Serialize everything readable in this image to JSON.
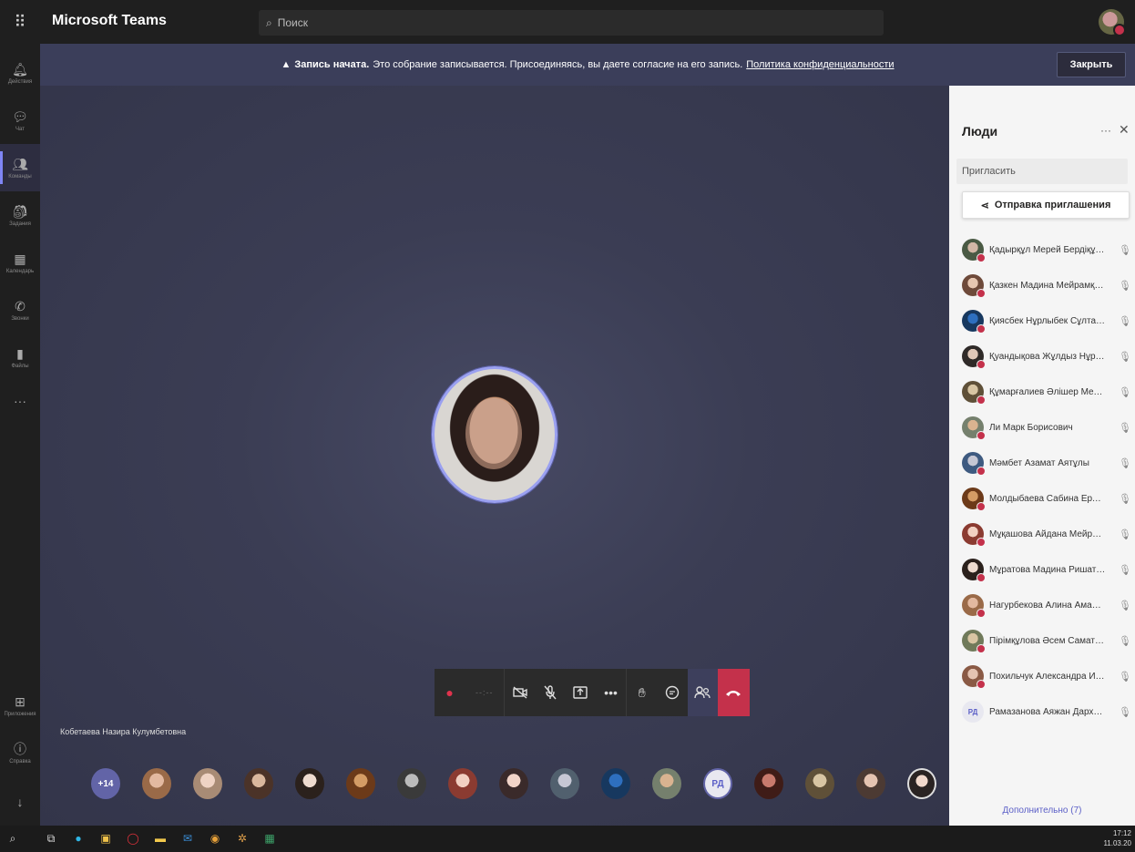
{
  "app": {
    "name": "Microsoft Teams",
    "search_placeholder": "Поиск"
  },
  "rail": {
    "items": [
      {
        "label": "Действия",
        "icon": "bell-icon",
        "active": false
      },
      {
        "label": "Чат",
        "icon": "chat-icon",
        "active": false
      },
      {
        "label": "Команды",
        "icon": "teams-icon",
        "active": true
      },
      {
        "label": "Задания",
        "icon": "assignments-icon",
        "active": false
      },
      {
        "label": "Календарь",
        "icon": "calendar-icon",
        "active": false
      },
      {
        "label": "Звонки",
        "icon": "phone-icon",
        "active": false
      },
      {
        "label": "Файлы",
        "icon": "files-icon",
        "active": false
      }
    ],
    "bottom": [
      {
        "label": "Приложения",
        "icon": "apps-icon"
      },
      {
        "label": "Справка",
        "icon": "help-icon"
      }
    ]
  },
  "banner": {
    "bold": "Запись начата.",
    "text": "Это собрание записывается. Присоединяясь, вы даете согласие на его запись.",
    "link": "Политика конфиденциальности",
    "close": "Закрыть"
  },
  "stage": {
    "speaker_name": "Кобетаева Назира Кулумбетовна"
  },
  "strip": {
    "more_count": "+14",
    "initials": "РД"
  },
  "people": {
    "title": "Люди",
    "invite_placeholder": "Пригласить",
    "send_invite": "Отправка приглашения",
    "participants": [
      "Қадырқұл Мерей Бердіқұл...",
      "Қазкен Мадина Мейрамқы...",
      "Қиясбек Нұрлыбек Сұлтан...",
      "Қуандықова Жұлдыз Нұры...",
      "Құмарғалиев Әлішер Меде...",
      "Ли Марк Борисович",
      "Мәмбет Азамат Аятұлы",
      "Молдыбаева Сабина Ерлан...",
      "Мұқашова Айдана Мейрам...",
      "Мұратова Мадина Ришатқ...",
      "Нагурбекова Алина Аманге...",
      "Пірімқұлова Әсем Саматқы...",
      "Похильчук Александра Ив...",
      "Рамазанова Аяжан Дархан..."
    ],
    "last_initials": "РД",
    "more_link": "Дополнительно (7)"
  },
  "taskbar": {
    "time": "17:12",
    "date": "11.03.20"
  }
}
